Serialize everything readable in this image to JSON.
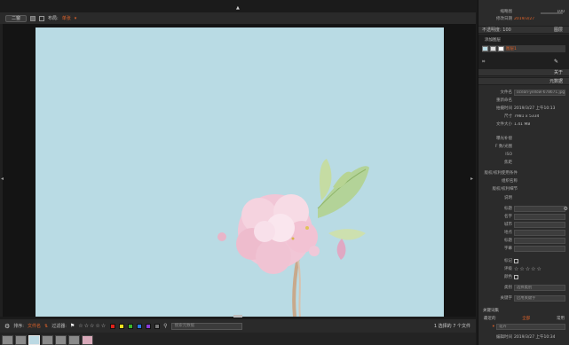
{
  "toolbar": {
    "mode_button": "二窗",
    "layout_label": "布局:",
    "layout_value": "单张"
  },
  "bottom_bar": {
    "sort_label": "排序:",
    "sort_value": "文件名",
    "filter_label": "过滤器:",
    "stars": "☆☆☆☆☆",
    "color_swatches": [
      "#e0231b",
      "#f0e020",
      "#3bb52c",
      "#2a78e4",
      "#8a3bd8",
      "#777777"
    ],
    "search_placeholder": "搜索元数据",
    "page_info": "1 选择的 7 个文件"
  },
  "right_panel": {
    "top_rows": [
      {
        "label": "缩略图",
        "value": "100"
      },
      {
        "label": "修改日期",
        "value": "2019/3/27"
      }
    ],
    "opacity_label": "不透明度: 100",
    "layers_tab": "图层",
    "add_layer": "添加图层",
    "layer_name": "图层1",
    "section_tabs": [
      "关于",
      "元数据"
    ],
    "metadata": [
      {
        "label": "文件名",
        "value": "ocean-yellow-678671.jpg"
      },
      {
        "label": "重新命名",
        "value": ""
      },
      {
        "label": "拍摄时间",
        "value": "2019/3/27 上午10:13"
      },
      {
        "label": "尺寸",
        "value": "7981 x 5334"
      },
      {
        "label": "文件大小",
        "value": "1.41 MB"
      },
      {
        "label": "曝光补偿",
        "value": ""
      },
      {
        "label": "F 数/光圈",
        "value": ""
      },
      {
        "label": "ISO",
        "value": ""
      },
      {
        "label": "焦距",
        "value": ""
      },
      {
        "label": "版权/权利使用条件",
        "value": ""
      },
      {
        "label": "组织名称",
        "value": ""
      },
      {
        "label": "版权/权利细节",
        "value": ""
      },
      {
        "label": "说明",
        "value": ""
      },
      {
        "label": "标题",
        "value": ""
      },
      {
        "label": "名字",
        "value": ""
      },
      {
        "label": "城市",
        "value": ""
      },
      {
        "label": "地点",
        "value": ""
      },
      {
        "label": "标题",
        "value": ""
      },
      {
        "label": "字幕",
        "value": ""
      }
    ],
    "tag_label": "标记",
    "rating_label": "评级",
    "rating_stars": "☆☆☆☆☆",
    "color_label": "颜色",
    "category_label": "类别",
    "category_placeholder": "选择类别",
    "keywords_label": "关键字",
    "keywords_placeholder": "启用关键字",
    "keyword_set_header": "关键词集",
    "recent_label": "最近的",
    "all_label": "全部",
    "common_label": "常用",
    "keyword_value": "花卉",
    "edit_time_label": "编辑时间",
    "edit_time_value": "2019/3/27 上午10:34"
  }
}
